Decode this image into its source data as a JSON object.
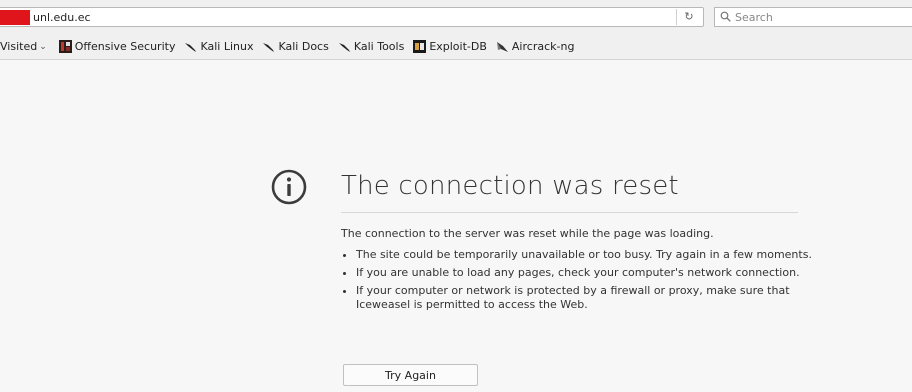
{
  "urlbar": {
    "url": "unl.edu.ec",
    "reload_icon": "↻"
  },
  "search": {
    "placeholder": "Search"
  },
  "bookmarks": {
    "visited_label": "Visited",
    "items": [
      {
        "label": "Offensive Security",
        "icon": "offensive-security-icon"
      },
      {
        "label": "Kali Linux",
        "icon": "kali-dragon-icon"
      },
      {
        "label": "Kali Docs",
        "icon": "kali-dragon-icon"
      },
      {
        "label": "Kali Tools",
        "icon": "kali-dragon-icon"
      },
      {
        "label": "Exploit-DB",
        "icon": "exploit-db-icon"
      },
      {
        "label": "Aircrack-ng",
        "icon": "aircrack-icon"
      }
    ]
  },
  "error": {
    "title": "The connection was reset",
    "description": "The connection to the server was reset while the page was loading.",
    "bullets": [
      "The site could be temporarily unavailable or too busy. Try again in a few moments.",
      "If you are unable to load any pages, check your computer's network connection.",
      "If your computer or network is protected by a firewall or proxy, make sure that Iceweasel is permitted to access the Web."
    ],
    "button_label": "Try Again"
  },
  "colors": {
    "redaction": "#e0141b",
    "background": "#f7f7f7"
  }
}
